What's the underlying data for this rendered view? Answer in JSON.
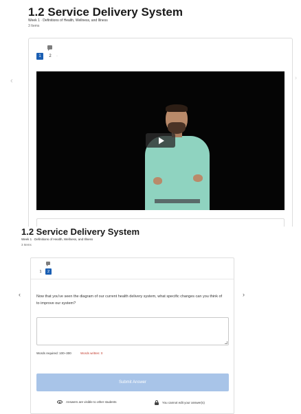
{
  "screen1": {
    "title": "1.2 Service Delivery System",
    "subtitle": "Week 1 · Definitions of Health, Wellness, and Illness",
    "items_count": "3 Items",
    "nav": {
      "prev_glyph": "‹",
      "next_glyph": "›"
    },
    "pagination": {
      "item_1": "1",
      "item_2": "2",
      "more": "·"
    },
    "video": {
      "state": "paused"
    }
  },
  "screen2": {
    "title": "1.2 Service Delivery System",
    "subtitle": "Week 1 · Definitions of Health, Wellness, and Illness",
    "items_count": "3 Items",
    "nav": {
      "prev_glyph": "‹",
      "next_glyph": "›"
    },
    "pagination": {
      "item_1": "1",
      "item_2": "2",
      "active": "2"
    },
    "question": "Now that you've seen the diagram of our current health delivery system, what specific changes can you think of to improve our system?",
    "answer": {
      "value": "",
      "placeholder": ""
    },
    "words_required": "Words required: 100–300",
    "words_written": "Words written: 0",
    "submit_label": "Submit Answer",
    "visibility_note": "Answers are visible to other students",
    "edit_note": "You cannot edit your answer(s)"
  },
  "colors": {
    "accent": "#1b5fb3",
    "submit_disabled": "#a8c4e8",
    "error_text": "#c0392b",
    "video_bg": "#050505",
    "shirt": "#8fd3c0"
  },
  "icons": [
    "chat-icon",
    "play-icon",
    "eye-icon",
    "lock-icon",
    "chevron-left-icon",
    "chevron-right-icon"
  ]
}
